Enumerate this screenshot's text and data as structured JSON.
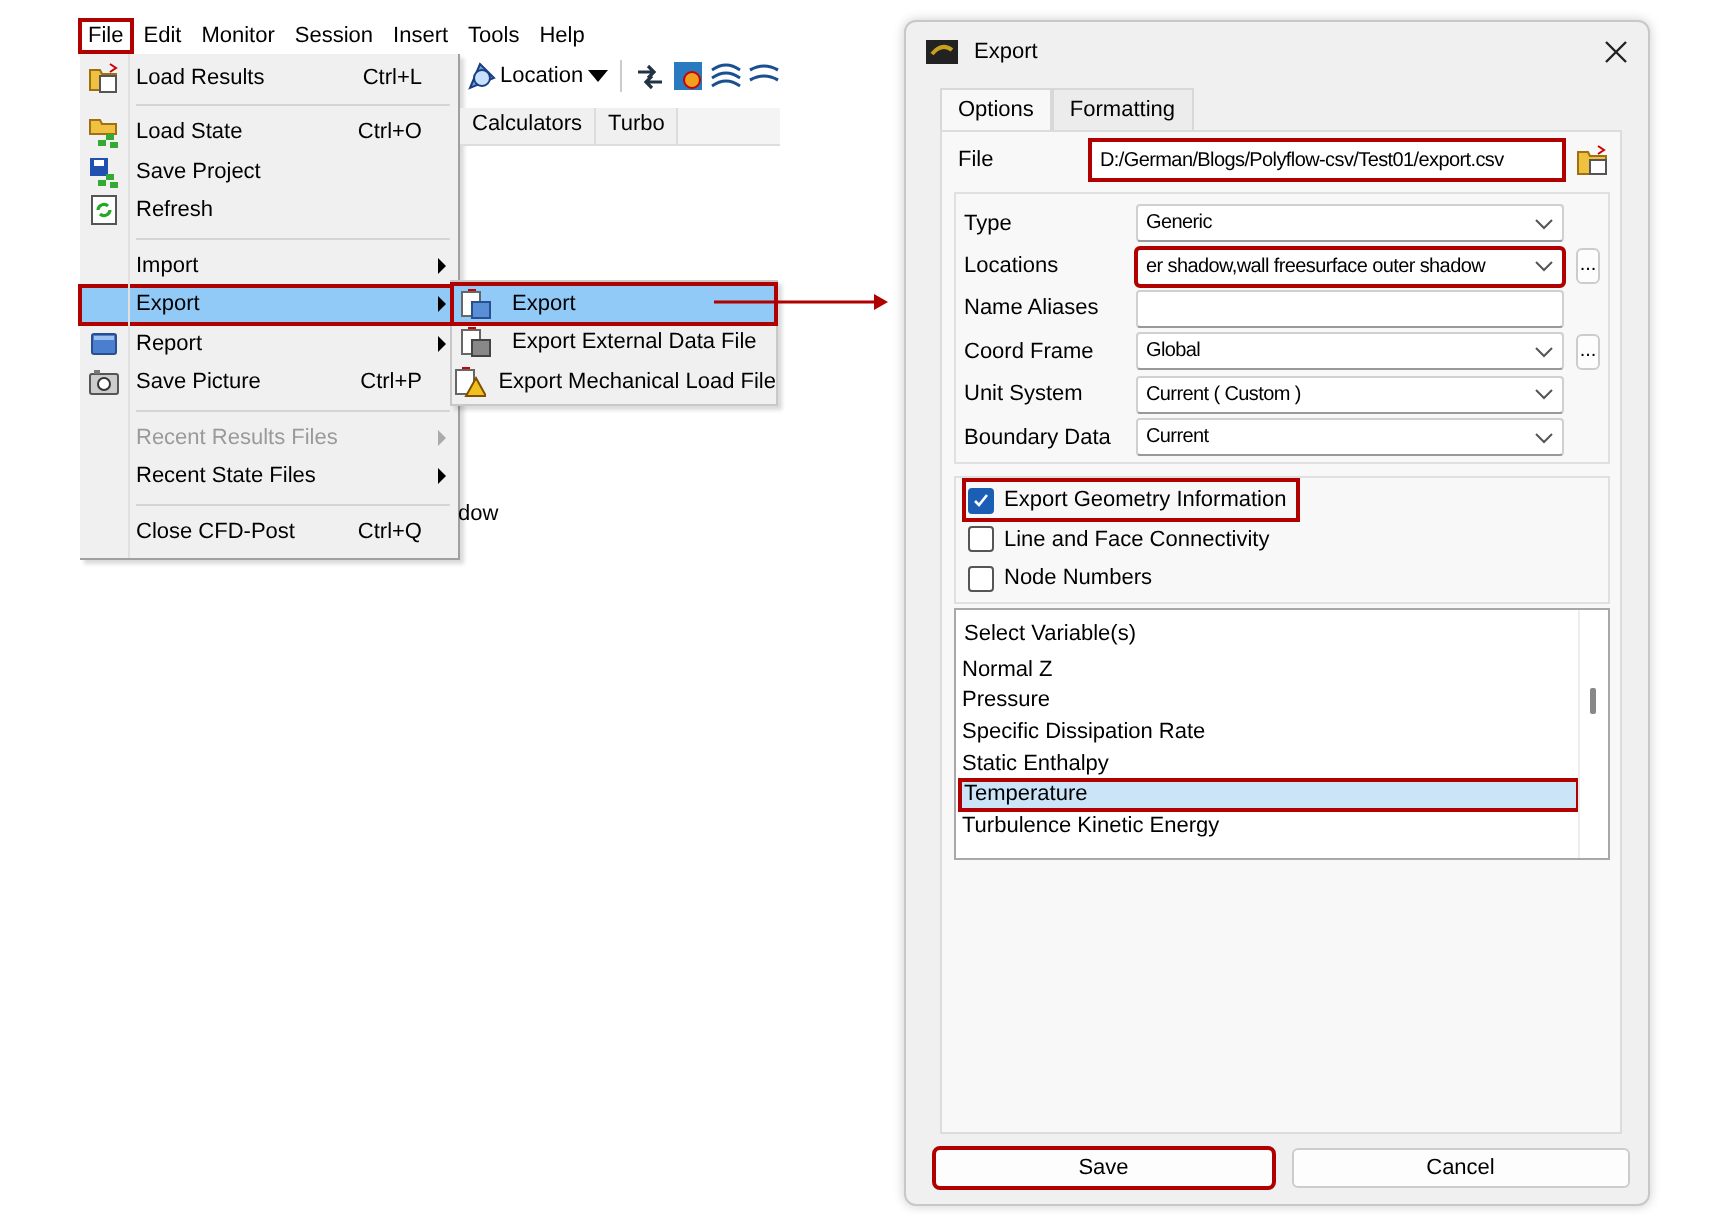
{
  "menubar": [
    {
      "label": "File",
      "highlighted": true
    },
    {
      "label": "Edit",
      "highlighted": false
    },
    {
      "label": "Monitor",
      "highlighted": false
    },
    {
      "label": "Session",
      "highlighted": false
    },
    {
      "label": "Insert",
      "highlighted": false
    },
    {
      "label": "Tools",
      "highlighted": false
    },
    {
      "label": "Help",
      "highlighted": false
    }
  ],
  "file_menu": [
    {
      "kind": "item",
      "label": "Load Results",
      "shortcut": "Ctrl+L",
      "submenu": false,
      "disabled": false,
      "selected": false,
      "highlighted": false
    },
    {
      "kind": "separator"
    },
    {
      "kind": "item",
      "label": "Load State",
      "shortcut": "Ctrl+O",
      "submenu": false,
      "disabled": false,
      "selected": false,
      "highlighted": false
    },
    {
      "kind": "item",
      "label": "Save Project",
      "submenu": false,
      "disabled": false,
      "selected": false,
      "highlighted": false
    },
    {
      "kind": "item",
      "label": "Refresh",
      "submenu": false,
      "disabled": false,
      "selected": false,
      "highlighted": false
    },
    {
      "kind": "separator"
    },
    {
      "kind": "item",
      "label": "Import",
      "submenu": true,
      "disabled": false,
      "selected": false,
      "highlighted": false
    },
    {
      "kind": "item",
      "label": "Export",
      "submenu": true,
      "disabled": false,
      "selected": true,
      "highlighted": true
    },
    {
      "kind": "item",
      "label": "Report",
      "submenu": true,
      "disabled": false,
      "selected": false,
      "highlighted": false
    },
    {
      "kind": "item",
      "label": "Save Picture",
      "shortcut": "Ctrl+P",
      "submenu": false,
      "disabled": false,
      "selected": false,
      "highlighted": false
    },
    {
      "kind": "separator"
    },
    {
      "kind": "item",
      "label": "Recent Results Files",
      "submenu": true,
      "disabled": true,
      "selected": false,
      "highlighted": false
    },
    {
      "kind": "item",
      "label": "Recent State Files",
      "submenu": true,
      "disabled": false,
      "selected": false,
      "highlighted": false
    },
    {
      "kind": "separator"
    },
    {
      "kind": "item",
      "label": "Close CFD-Post",
      "shortcut": "Ctrl+Q",
      "submenu": false,
      "disabled": false,
      "selected": false,
      "highlighted": false
    }
  ],
  "export_submenu": [
    {
      "label": "Export",
      "selected": true,
      "highlighted": true
    },
    {
      "label": "Export External Data File",
      "selected": false,
      "highlighted": false
    },
    {
      "label": "Export Mechanical Load File",
      "selected": false,
      "highlighted": false
    }
  ],
  "toolbar": {
    "location_label": "Location"
  },
  "background_tabs": [
    "Calculators",
    "Turbo"
  ],
  "background_text": "dow",
  "dialog": {
    "title": "Export",
    "tabs": [
      {
        "label": "Options",
        "selected": true
      },
      {
        "label": "Formatting",
        "selected": false
      }
    ],
    "file": {
      "label": "File",
      "value": "D:/German/Blogs/Polyflow-csv/Test01/export.csv",
      "highlighted": true
    },
    "fields": [
      {
        "label": "Type",
        "kind": "dropdown",
        "value": "Generic",
        "more_button": false,
        "highlighted": false
      },
      {
        "label": "Locations",
        "kind": "dropdown",
        "value": "er shadow,wall freesurface outer shadow",
        "more_button": true,
        "more_label": "...",
        "highlighted": true
      },
      {
        "label": "Name Aliases",
        "kind": "text",
        "more_button": false,
        "highlighted": false
      },
      {
        "label": "Coord Frame",
        "kind": "dropdown",
        "value": "Global",
        "more_button": true,
        "more_label": "...",
        "highlighted": false
      },
      {
        "label": "Unit System",
        "kind": "dropdown",
        "value": "Current ( Custom )",
        "more_button": false,
        "highlighted": false
      },
      {
        "label": "Boundary Data",
        "kind": "dropdown",
        "value": "Current",
        "more_button": false,
        "highlighted": false
      }
    ],
    "options": [
      {
        "label": "Export Geometry Information",
        "checked": true,
        "highlighted": true
      },
      {
        "label": "Line and Face Connectivity",
        "checked": false,
        "highlighted": false
      },
      {
        "label": "Node Numbers",
        "checked": false,
        "highlighted": false
      }
    ],
    "variables": {
      "header": "Select Variable(s)",
      "items": [
        {
          "label": "Normal Z",
          "selected": false,
          "highlighted": false
        },
        {
          "label": "Pressure",
          "selected": false,
          "highlighted": false
        },
        {
          "label": "Specific Dissipation Rate",
          "selected": false,
          "highlighted": false
        },
        {
          "label": "Static Enthalpy",
          "selected": false,
          "highlighted": false
        },
        {
          "label": "Temperature",
          "selected": true,
          "highlighted": true
        },
        {
          "label": "Turbulence Kinetic Energy",
          "selected": false,
          "highlighted": false
        }
      ]
    },
    "buttons": [
      {
        "label": "Save",
        "highlighted": true
      },
      {
        "label": "Cancel",
        "highlighted": false
      }
    ]
  }
}
